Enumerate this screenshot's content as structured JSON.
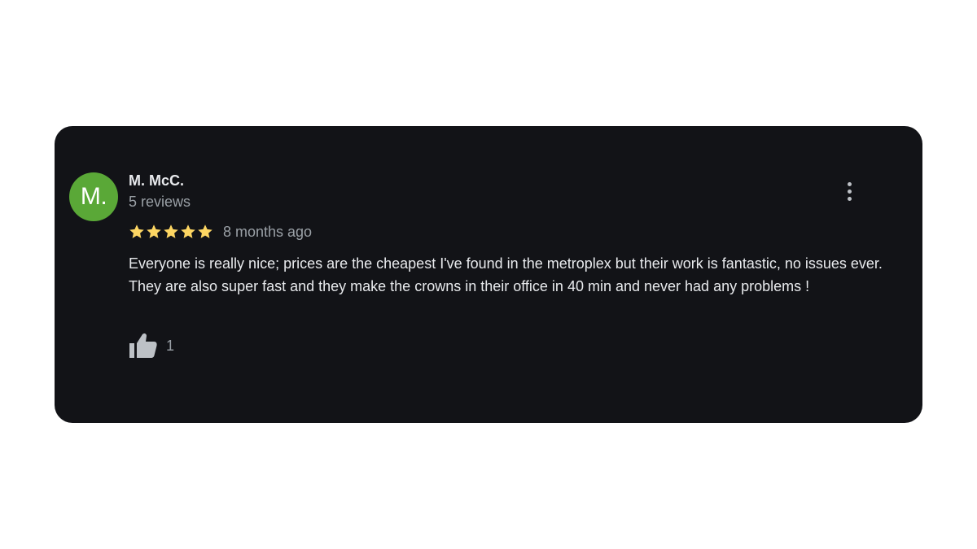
{
  "review": {
    "avatar_initials": "M.",
    "avatar_color": "#5aa837",
    "author": "M. McC.",
    "review_count": "5 reviews",
    "rating": 5,
    "rating_max": 5,
    "star_color": "#fdd663",
    "date": "8 months ago",
    "text": "Everyone is really nice; prices are the cheapest I've found in the metroplex but their work is fantastic, no issues ever. They are also super fast and they make the crowns in their office in 40 min and never had any problems !",
    "likes": "1",
    "like_icon": "thumbs-up-icon",
    "menu_icon": "more-vert-icon"
  },
  "theme": {
    "card_background": "#121317",
    "page_background": "#ffffff"
  }
}
